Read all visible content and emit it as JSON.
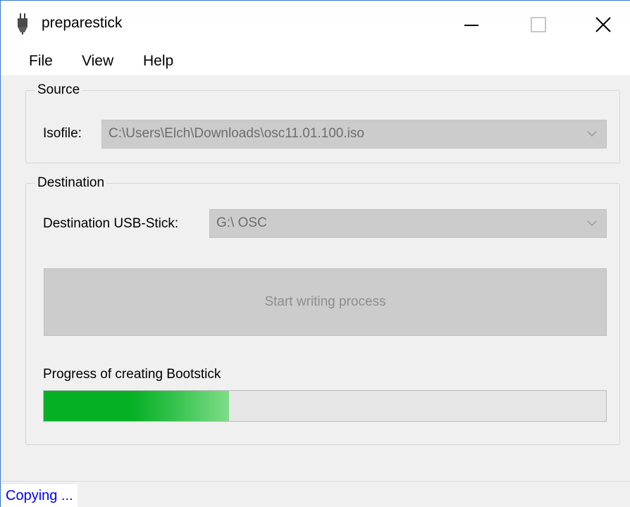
{
  "window": {
    "title": "preparestick",
    "icon": "usb-plug-icon"
  },
  "menu": {
    "items": [
      "File",
      "View",
      "Help"
    ]
  },
  "source": {
    "group_label": "Source",
    "isofile_label": "Isofile:",
    "isofile_value": "C:\\Users\\Elch\\Downloads\\osc11.01.100.iso"
  },
  "destination": {
    "group_label": "Destination",
    "usb_label": "Destination USB-Stick:",
    "usb_value": "G:\\ OSC",
    "start_button_label": "Start writing process",
    "progress_label": "Progress of creating Bootstick",
    "progress_fraction": 0.33
  },
  "status": {
    "text": "Copying ..."
  },
  "colors": {
    "progress_green": "#06b025",
    "status_text": "#0000ff"
  }
}
